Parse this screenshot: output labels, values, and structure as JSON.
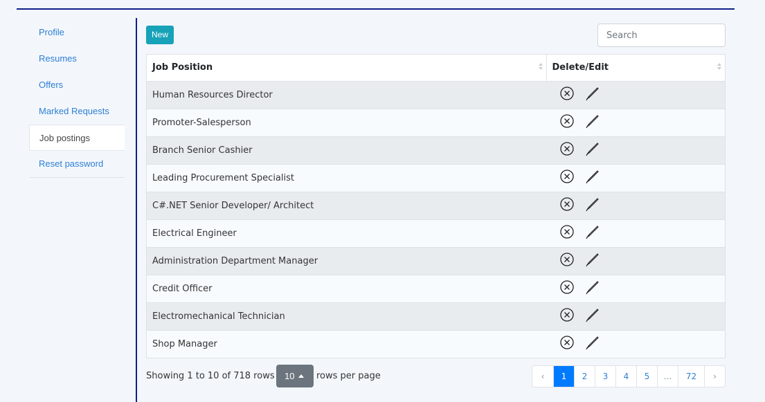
{
  "sidebar": {
    "items": [
      {
        "label": "Profile",
        "active": false
      },
      {
        "label": "Resumes",
        "active": false
      },
      {
        "label": "Offers",
        "active": false
      },
      {
        "label": "Marked Requests",
        "active": false
      },
      {
        "label": "Job postings",
        "active": true
      },
      {
        "label": "Reset password",
        "active": false
      }
    ]
  },
  "toolbar": {
    "new_label": "New",
    "search_placeholder": "Search"
  },
  "table": {
    "columns": [
      "Job Position",
      "Delete/Edit"
    ],
    "rows": [
      "Human Resources Director",
      "Promoter-Salesperson",
      "Branch Senior Cashier",
      "Leading Procurement Specialist",
      "C#.NET Senior Developer/ Architect",
      "Electrical Engineer",
      "Administration Department Manager",
      "Credit Officer",
      "Electromechanical Technician",
      "Shop Manager"
    ],
    "row_action_icons": [
      "delete-icon",
      "edit-icon"
    ]
  },
  "footer": {
    "showing": "Showing 1 to 10 of 718 rows",
    "page_size": "10",
    "rows_per_page": "rows per page",
    "pages": [
      "‹",
      "1",
      "2",
      "3",
      "4",
      "5",
      "...",
      "72",
      "›"
    ],
    "current_page": "1"
  },
  "colors": {
    "accent_rule": "#0f1f8a",
    "new_button": "#17a2b8",
    "active_page": "#007bff",
    "link": "#2d7fd3"
  }
}
